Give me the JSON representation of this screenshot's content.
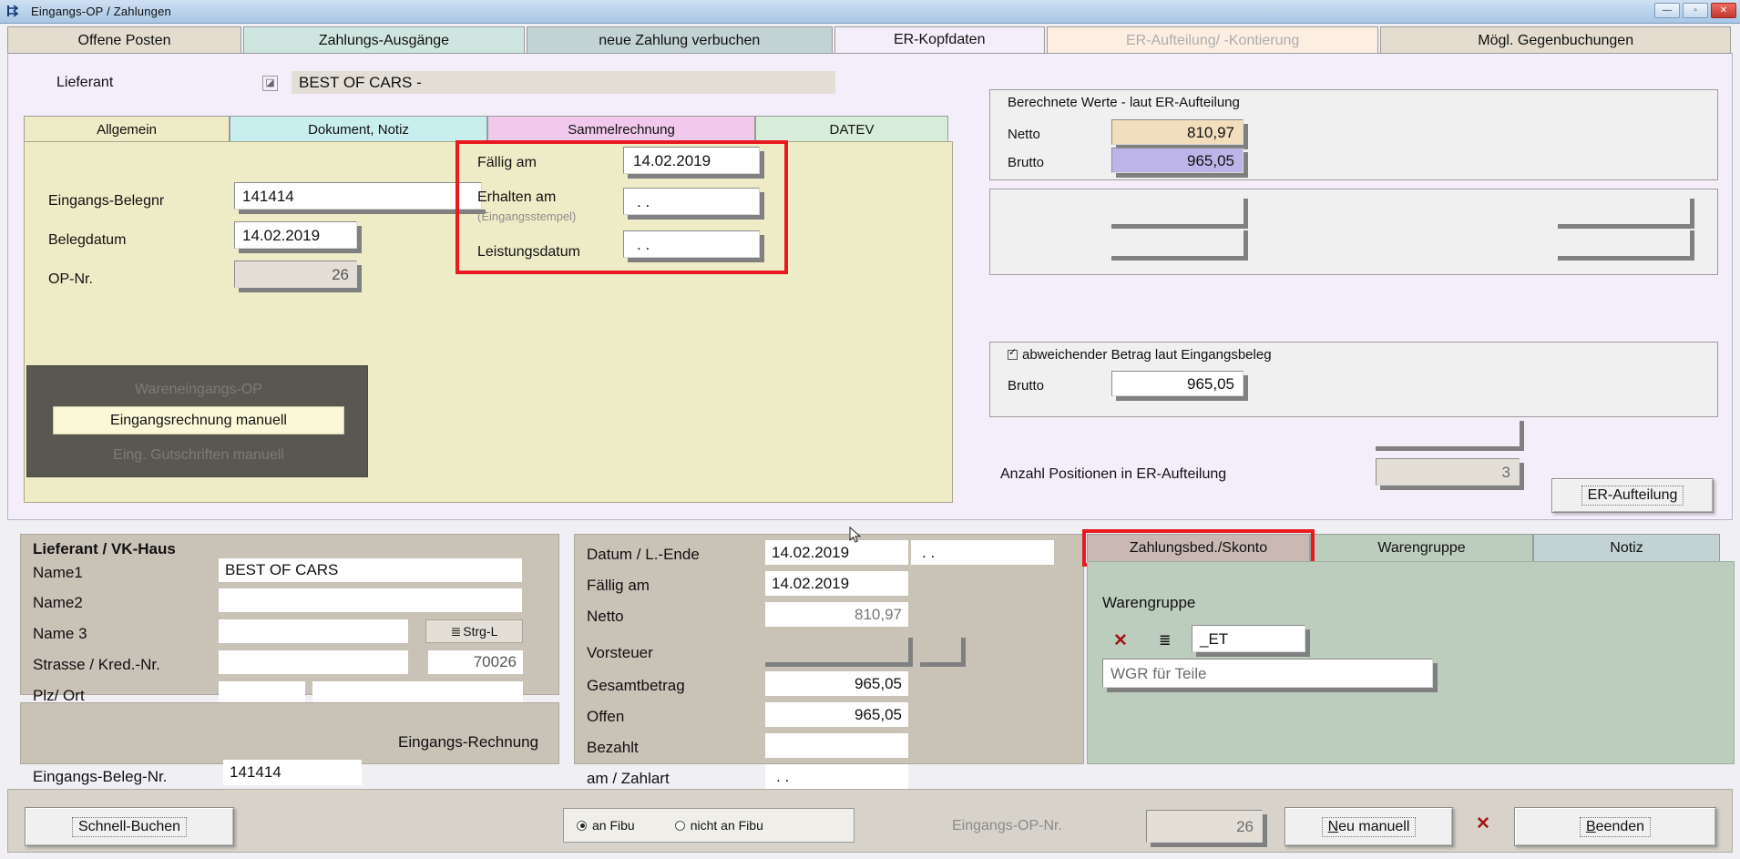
{
  "window": {
    "title": "Eingangs-OP / Zahlungen",
    "icon": "app-window-icon",
    "minimize": "—",
    "maximize": "▫",
    "close": "✕"
  },
  "outer_tabs": [
    {
      "label": "Offene Posten",
      "state": "normal",
      "color": "#e3dccf"
    },
    {
      "label": "Zahlungs-Ausgänge",
      "state": "normal",
      "color": "#cfe6e0"
    },
    {
      "label": "neue Zahlung verbuchen",
      "state": "normal",
      "color": "#c3d3d4"
    },
    {
      "label": "ER-Kopfdaten",
      "state": "active",
      "color": "#f3eefa"
    },
    {
      "label": "ER-Aufteilung/ -Kontierung",
      "state": "disabled",
      "color": "#fdeee2"
    },
    {
      "label": "Mögl. Gegenbuchungen",
      "state": "normal",
      "color": "#e3dccf"
    }
  ],
  "supplier_header": {
    "label": "Lieferant",
    "picker_icon": "lookup-icon",
    "value": "BEST OF CARS -"
  },
  "inner_tabs": [
    {
      "label": "Allgemein",
      "state": "active",
      "color": "#eeecc6"
    },
    {
      "label": "Dokument, Notiz",
      "state": "normal",
      "color": "#c9eeee"
    },
    {
      "label": "Sammelrechnung",
      "state": "normal",
      "color": "#f0c9ec"
    },
    {
      "label": "DATEV",
      "state": "normal",
      "color": "#d7ecd9"
    }
  ],
  "allgemein": {
    "fields": [
      {
        "label": "Eingangs-Belegnr",
        "value": "141414"
      },
      {
        "label": "Belegdatum",
        "value": "14.02.2019"
      },
      {
        "label": "OP-Nr.",
        "value": "26"
      }
    ],
    "date_box": {
      "highlighted": true,
      "highlight_color": "#e8191f",
      "rows": [
        {
          "label": "Fällig am",
          "sublabel": "",
          "value": "14.02.2019"
        },
        {
          "label": "Erhalten am",
          "sublabel": "(Eingangsstempel)",
          "value": ".  ."
        },
        {
          "label": "Leistungsdatum",
          "sublabel": "",
          "value": ".  ."
        }
      ]
    },
    "mode_panel": {
      "items": [
        {
          "label": "Wareneingangs-OP",
          "state": "disabled"
        },
        {
          "label": "Eingangsrechnung manuell",
          "state": "selected"
        },
        {
          "label": "Eing. Gutschriften manuell",
          "state": "disabled"
        }
      ]
    }
  },
  "computed": {
    "title": "Berechnete Werte - laut ER-Aufteilung",
    "rows": [
      {
        "label": "Netto",
        "value": "810,97",
        "color": "#f2debd"
      },
      {
        "label": "Brutto",
        "value": "965,05",
        "color": "#bdb5ea"
      }
    ]
  },
  "deviating": {
    "checkbox_label": "abweichender Betrag laut Eingangsbeleg",
    "checked": true,
    "row": {
      "label": "Brutto",
      "value": "965,05"
    }
  },
  "positions": {
    "label": "Anzahl Positionen in ER-Aufteilung",
    "value": "3",
    "button": "ER-Aufteilung"
  },
  "supplier_card": {
    "title": "Lieferant / VK-Haus",
    "rows": [
      {
        "label": "Name1",
        "value": "BEST OF CARS"
      },
      {
        "label": "Name2",
        "value": ""
      },
      {
        "label": "Name 3",
        "value": "",
        "side_button": "Strg-L",
        "side_icon": "list-icon"
      },
      {
        "label": "Strasse / Kred.-Nr.",
        "value": "",
        "side_value": "70026"
      },
      {
        "label": "Plz/ Ort",
        "value": "",
        "value2": ""
      }
    ]
  },
  "incoming_invoice": {
    "title": "Eingangs-Rechnung",
    "label": "Eingangs-Beleg-Nr.",
    "value": "141414"
  },
  "amounts": {
    "rows": [
      {
        "label": "Datum / L.-Ende",
        "value": "14.02.2019",
        "value2": ".  ."
      },
      {
        "label": "Fällig am",
        "value": "14.02.2019"
      },
      {
        "label": "Netto",
        "value": "810,97",
        "readonly": true
      },
      {
        "label": "Vorsteuer",
        "value": "",
        "ghost": true
      },
      {
        "label": "Gesamtbetrag",
        "value": "965,05"
      },
      {
        "label": "Offen",
        "value": "965,05"
      },
      {
        "label": "Bezahlt",
        "value": ""
      },
      {
        "label": "am / Zahlart",
        "value": ".  ."
      }
    ]
  },
  "right_tabs": [
    {
      "label": "Zahlungsbed./Skonto",
      "state": "highlighted",
      "color": "#c9b9b2"
    },
    {
      "label": "Warengruppe",
      "state": "active",
      "color": "#bccdbd"
    },
    {
      "label": "Notiz",
      "state": "normal",
      "color": "#c3d3d4"
    }
  ],
  "warengruppe": {
    "title": "Warengruppe",
    "clear_icon": "x-icon",
    "list_icon": "list-icon",
    "code": "_ET",
    "description": "WGR für Teile"
  },
  "bottom": {
    "quick_book": "Schnell-Buchen",
    "fibu_options": [
      {
        "label": "an Fibu",
        "selected": true
      },
      {
        "label": "nicht an Fibu",
        "selected": false
      }
    ],
    "op_label": "Eingangs-OP-Nr.",
    "op_value": "26",
    "new_manual": "Neu manuell",
    "delete_icon": "x-icon",
    "close_button": "Beenden"
  }
}
